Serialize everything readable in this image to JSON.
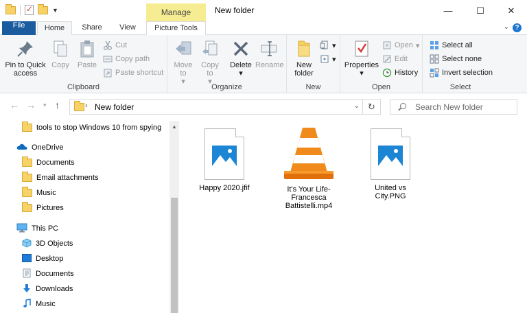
{
  "window": {
    "title": "New folder",
    "context_tab_label": "Manage",
    "controls": {
      "minimize": "—",
      "maximize": "☐",
      "close": "✕"
    }
  },
  "tabs": {
    "file": "File",
    "home": "Home",
    "share": "Share",
    "view": "View",
    "picture_tools": "Picture Tools"
  },
  "ribbon": {
    "clipboard": {
      "label": "Clipboard",
      "pin": "Pin to Quick access",
      "copy": "Copy",
      "paste": "Paste",
      "cut": "Cut",
      "copy_path": "Copy path",
      "paste_shortcut": "Paste shortcut"
    },
    "organize": {
      "label": "Organize",
      "move_to": "Move to",
      "copy_to": "Copy to",
      "delete": "Delete",
      "rename": "Rename"
    },
    "new": {
      "label": "New",
      "new_folder": "New folder"
    },
    "open": {
      "label": "Open",
      "properties": "Properties",
      "open": "Open",
      "edit": "Edit",
      "history": "History"
    },
    "select": {
      "label": "Select",
      "select_all": "Select all",
      "select_none": "Select none",
      "invert_selection": "Invert selection"
    }
  },
  "address": {
    "path": "New folder",
    "search_placeholder": "Search New folder"
  },
  "nav": {
    "items": [
      {
        "label": "tools to stop Windows 10 from spying",
        "icon": "folder-icon"
      },
      {
        "label": "OneDrive",
        "icon": "cloud-icon"
      },
      {
        "label": "Documents",
        "icon": "folder-icon"
      },
      {
        "label": "Email attachments",
        "icon": "folder-icon"
      },
      {
        "label": "Music",
        "icon": "folder-icon"
      },
      {
        "label": "Pictures",
        "icon": "folder-icon"
      },
      {
        "label": "This PC",
        "icon": "computer-icon"
      },
      {
        "label": "3D Objects",
        "icon": "cube-icon"
      },
      {
        "label": "Desktop",
        "icon": "desktop-icon"
      },
      {
        "label": "Documents",
        "icon": "documents-icon"
      },
      {
        "label": "Downloads",
        "icon": "download-icon"
      },
      {
        "label": "Music",
        "icon": "music-icon"
      }
    ]
  },
  "files": [
    {
      "name": "Happy 2020.jfif",
      "icon": "image-file-icon"
    },
    {
      "name": "It's Your Life-Francesca Battistelli.mp4",
      "name_lines": [
        "It's Your Life-",
        "Francesca",
        "Battistelli.mp4"
      ],
      "icon": "vlc-cone-icon"
    },
    {
      "name": "United vs City.PNG",
      "name_lines": [
        "United vs",
        "City.PNG"
      ],
      "icon": "image-file-icon"
    }
  ],
  "colors": {
    "accent": "#1a5c9e",
    "manage_tab": "#f6ed93",
    "folder": "#f6d269",
    "image_icon": "#1d86d4",
    "vlc_orange": "#f08a1c"
  }
}
